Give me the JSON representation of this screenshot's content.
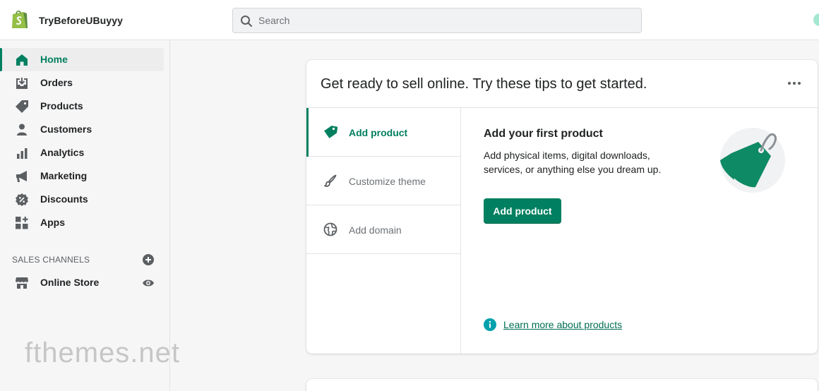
{
  "topbar": {
    "store_name": "TryBeforeUBuyyy",
    "search_placeholder": "Search"
  },
  "sidebar": {
    "items": [
      {
        "label": "Home",
        "icon": "home-icon",
        "active": true
      },
      {
        "label": "Orders",
        "icon": "orders-icon"
      },
      {
        "label": "Products",
        "icon": "tag-icon"
      },
      {
        "label": "Customers",
        "icon": "person-icon"
      },
      {
        "label": "Analytics",
        "icon": "bar-chart-icon"
      },
      {
        "label": "Marketing",
        "icon": "megaphone-icon"
      },
      {
        "label": "Discounts",
        "icon": "discount-icon"
      },
      {
        "label": "Apps",
        "icon": "apps-icon"
      }
    ],
    "sales_channels_label": "SALES CHANNELS",
    "channels": [
      {
        "label": "Online Store",
        "icon": "store-icon"
      }
    ]
  },
  "card": {
    "title": "Get ready to sell online. Try these tips to get started.",
    "tabs": [
      {
        "label": "Add product",
        "icon": "tag-icon",
        "active": true
      },
      {
        "label": "Customize theme",
        "icon": "brush-icon"
      },
      {
        "label": "Add domain",
        "icon": "globe-icon"
      }
    ],
    "panel": {
      "title": "Add your first product",
      "description": "Add physical items, digital downloads, services, or anything else you dream up.",
      "button_label": "Add product",
      "learn_more": "Learn more about products"
    }
  },
  "watermark": "fthemes.net",
  "colors": {
    "accent": "#008060",
    "accent_text": "#007f5f",
    "link": "#006e52"
  }
}
